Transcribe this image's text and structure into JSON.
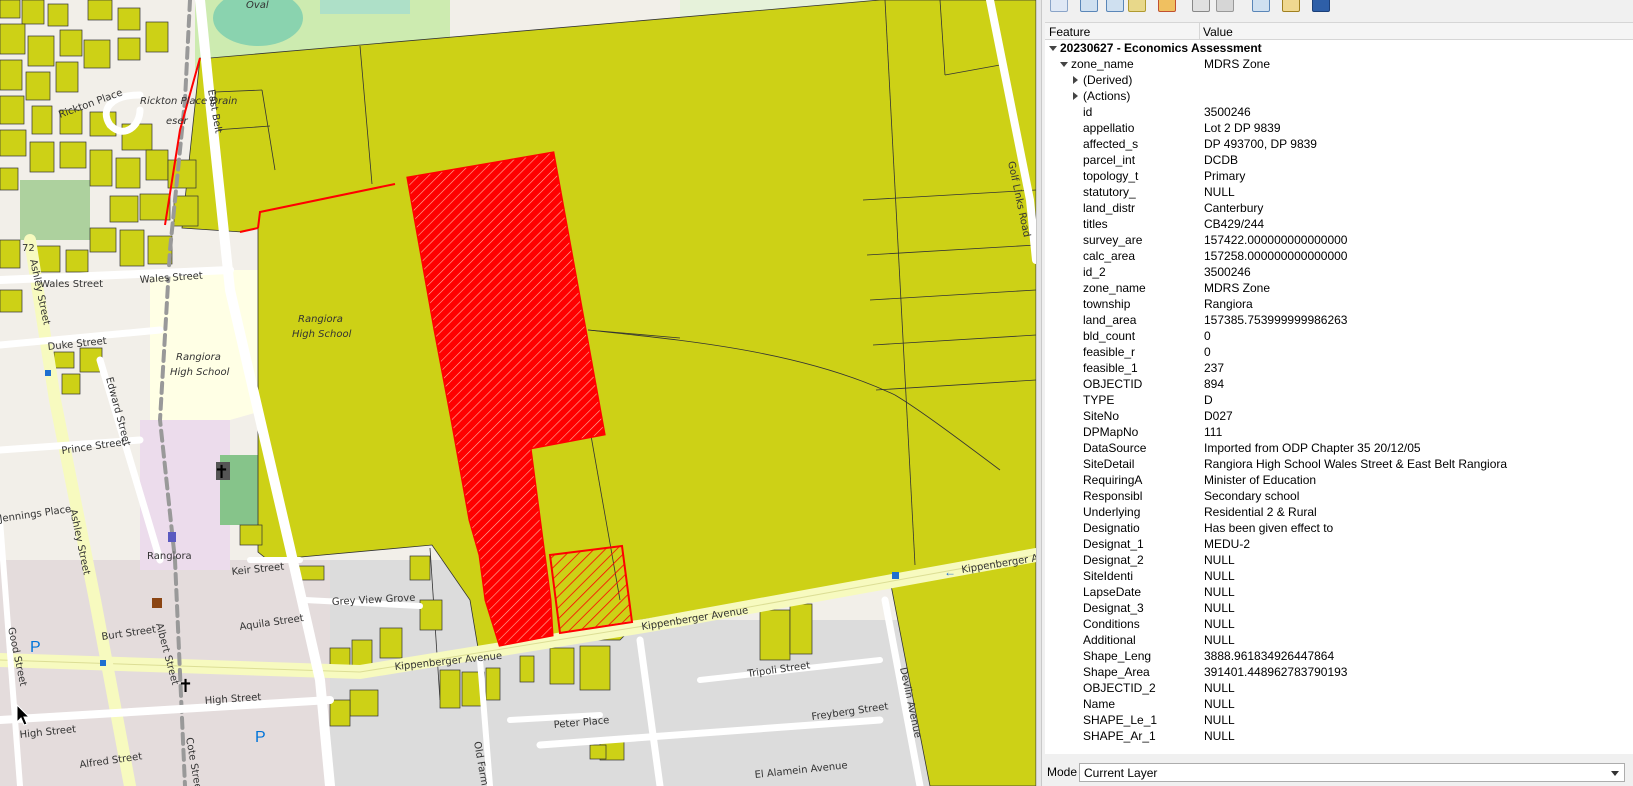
{
  "map": {
    "labels": {
      "oval": "Oval",
      "rickton_place": "Rickton Place",
      "rickton_place_drain": "Rickton Place Drain",
      "reserve": "eser",
      "east_belt": "East Belt",
      "wales_street_1": "Wales Street",
      "wales_street_2": "Wales Street",
      "duke_street": "Duke Street",
      "ashley_street_1": "Ashley Street",
      "ashley_street_2": "Ashley Street",
      "edward_street": "Edward Street",
      "prince_street": "Prince Street",
      "jennings_place": "Jennings Place",
      "rangiora_high_school_1_line1": "Rangiora",
      "rangiora_high_school_1_line2": "High School",
      "rangiora_high_school_2_line1": "Rangiora",
      "rangiora_high_school_2_line2": "High School",
      "rangiora": "Rangiora",
      "keir_street": "Keir Street",
      "grey_view_grove": "Grey View Grove",
      "aquila_street": "Aquila Street",
      "burt_street": "Burt Street",
      "albert_street": "Albert Street",
      "good_street": "Good Street",
      "high_street_1": "High Street",
      "high_street_2": "High Street",
      "alfred_street": "Alfred Street",
      "kippenberger_avenue_1": "Kippenberger Avenue",
      "kippenberger_avenue_2": "Kippenberger Avenue",
      "kippenberger_avenue_3": "Kippenberger A",
      "peter_place": "Peter Place",
      "old_farm": "Old Farm",
      "tripoli_street": "Tripoli Street",
      "freyberg_street": "Freyberg Street",
      "el_alamein_avenue": "El Alamein Avenue",
      "devlin_avenue": "Devlin Avenue",
      "golf_links_road": "Golf Links Road",
      "cote_street": "Cote Street",
      "route_72": "72"
    }
  },
  "panel": {
    "columns": {
      "feature": "Feature",
      "value": "Value"
    },
    "layer_title": "20230627 - Economics Assessment",
    "zone_name_label": "zone_name",
    "zone_name_value": "MDRS Zone",
    "derived": "(Derived)",
    "actions": "(Actions)",
    "attributes": [
      {
        "name": "id",
        "value": "3500246"
      },
      {
        "name": "appellatio",
        "value": "Lot 2 DP 9839"
      },
      {
        "name": "affected_s",
        "value": "DP 493700, DP 9839"
      },
      {
        "name": "parcel_int",
        "value": "DCDB"
      },
      {
        "name": "topology_t",
        "value": "Primary"
      },
      {
        "name": "statutory_",
        "value": "NULL"
      },
      {
        "name": "land_distr",
        "value": "Canterbury"
      },
      {
        "name": "titles",
        "value": "CB429/244"
      },
      {
        "name": "survey_are",
        "value": "157422.000000000000000"
      },
      {
        "name": "calc_area",
        "value": "157258.000000000000000"
      },
      {
        "name": "id_2",
        "value": "3500246"
      },
      {
        "name": "zone_name",
        "value": "MDRS Zone"
      },
      {
        "name": "township",
        "value": "Rangiora"
      },
      {
        "name": "land_area",
        "value": "157385.753999999986263"
      },
      {
        "name": "bld_count",
        "value": "0"
      },
      {
        "name": "feasible_r",
        "value": "0"
      },
      {
        "name": "feasible_1",
        "value": "237"
      },
      {
        "name": "OBJECTID",
        "value": "894"
      },
      {
        "name": "TYPE",
        "value": "D"
      },
      {
        "name": "SiteNo",
        "value": "D027"
      },
      {
        "name": "DPMapNo",
        "value": "111"
      },
      {
        "name": "DataSource",
        "value": "Imported from ODP Chapter 35 20/12/05"
      },
      {
        "name": "SiteDetail",
        "value": "Rangiora High School Wales Street & East Belt Rangiora"
      },
      {
        "name": "RequiringA",
        "value": "Minister of Education"
      },
      {
        "name": "Responsibl",
        "value": "Secondary school"
      },
      {
        "name": "Underlying",
        "value": "Residential 2 & Rural"
      },
      {
        "name": "Designatio",
        "value": "Has been given effect to"
      },
      {
        "name": "Designat_1",
        "value": "MEDU-2"
      },
      {
        "name": "Designat_2",
        "value": "NULL"
      },
      {
        "name": "SiteIdenti",
        "value": "NULL"
      },
      {
        "name": "LapseDate",
        "value": "NULL"
      },
      {
        "name": "Designat_3",
        "value": "NULL"
      },
      {
        "name": "Conditions",
        "value": "NULL"
      },
      {
        "name": "Additional",
        "value": "NULL"
      },
      {
        "name": "Shape_Leng",
        "value": "3888.961834926447864"
      },
      {
        "name": "Shape_Area",
        "value": "391401.448962783790193"
      },
      {
        "name": "OBJECTID_2",
        "value": "NULL"
      },
      {
        "name": "Name",
        "value": "NULL"
      },
      {
        "name": "SHAPE_Le_1",
        "value": "NULL"
      },
      {
        "name": "SHAPE_Ar_1",
        "value": "NULL"
      }
    ],
    "mode": {
      "label": "Mode",
      "value": "Current Layer"
    },
    "toolbar_icons": [
      "expand-tree-icon",
      "collapse-tree-icon",
      "expand-new-icon",
      "clear-results-icon",
      "copy-attributes-icon",
      "print-icon",
      "select-features-icon",
      "identify-icon",
      "help-icon"
    ]
  },
  "colors": {
    "zone_fill": "#cdd116",
    "selected_red": "#ff0000",
    "map_bg": "#f2efe9",
    "school_fill": "#ffffe5"
  }
}
